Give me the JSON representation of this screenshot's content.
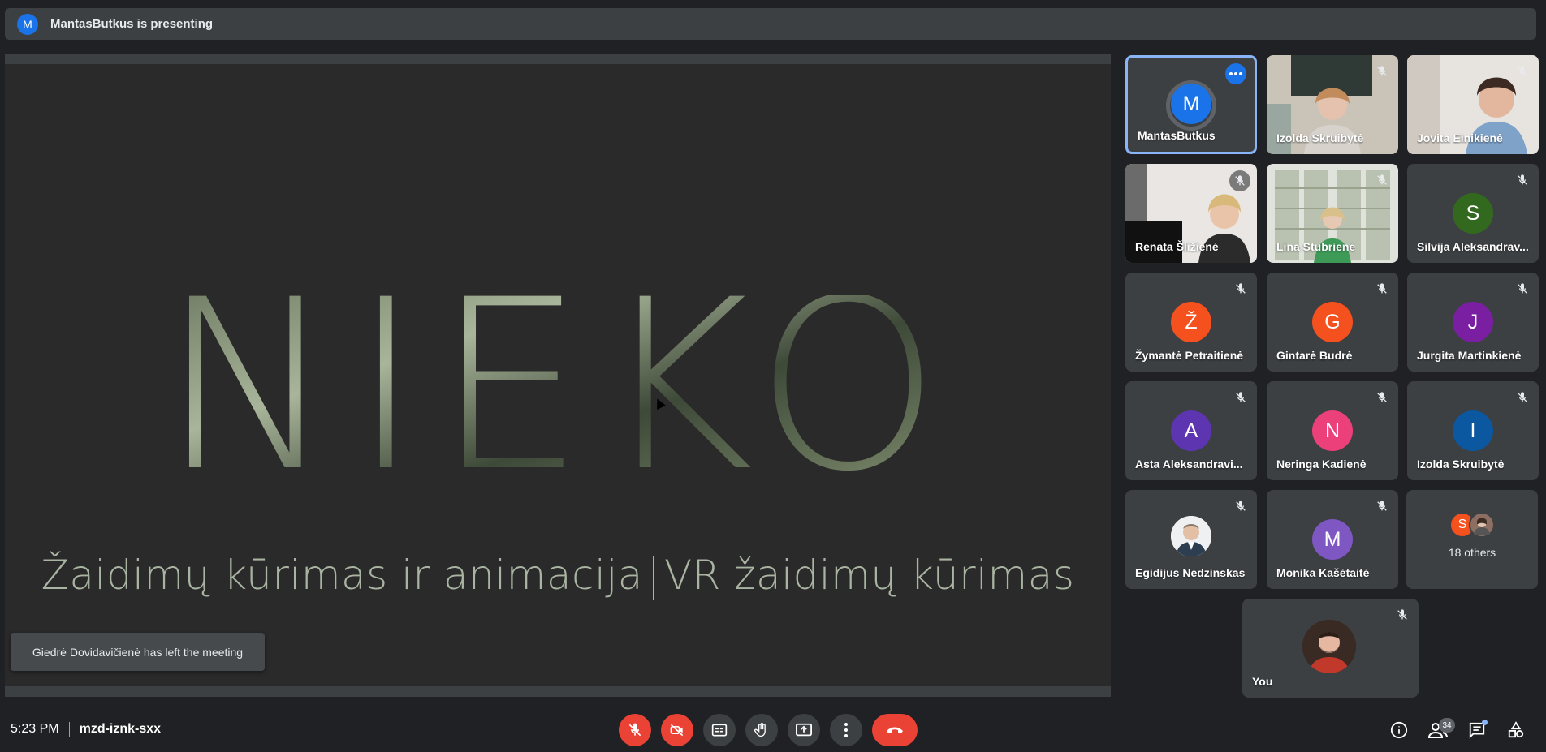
{
  "presenting": {
    "avatar_letter": "M",
    "text": "MantasButkus is presenting"
  },
  "slide": {
    "logo_text": "NIEKO",
    "subtitle_left": "Žaidimų kūrimas ir animacija",
    "subtitle_right": "VR žaidimų kūrimas"
  },
  "toast": "Giedrė Dovidavičienė has left the meeting",
  "participants": [
    {
      "name": "MantasButkus",
      "letter": "M",
      "color": "#1a73e8",
      "kind": "avatar-active"
    },
    {
      "name": "Izolda Skruibytė",
      "kind": "video"
    },
    {
      "name": "Jovita Einikienė",
      "kind": "video"
    },
    {
      "name": "Renata Šližienė",
      "kind": "video"
    },
    {
      "name": "Lina Stubrienė",
      "kind": "video"
    },
    {
      "name": "Silvija Aleksandrav...",
      "letter": "S",
      "color": "#33691e",
      "kind": "avatar"
    },
    {
      "name": "Žymantė Petraitienė",
      "letter": "Ž",
      "color": "#f4511e",
      "kind": "avatar"
    },
    {
      "name": "Gintarė Budrė",
      "letter": "G",
      "color": "#f4511e",
      "kind": "avatar"
    },
    {
      "name": "Jurgita Martinkienė",
      "letter": "J",
      "color": "#7b1fa2",
      "kind": "avatar"
    },
    {
      "name": "Asta Aleksandravi...",
      "letter": "A",
      "color": "#5e35b1",
      "kind": "avatar"
    },
    {
      "name": "Neringa Kadienė",
      "letter": "N",
      "color": "#ec407a",
      "kind": "avatar"
    },
    {
      "name": "Izolda Skruibytė",
      "letter": "I",
      "color": "#0b57a0",
      "kind": "avatar"
    },
    {
      "name": "Egidijus Nedzinskas",
      "kind": "photo"
    },
    {
      "name": "Monika Kašėtaitė",
      "letter": "M",
      "color": "#7e57c2",
      "kind": "avatar"
    }
  ],
  "others": {
    "label": "18 others",
    "mini_letter": "S",
    "mini_color": "#f4511e"
  },
  "self": {
    "name": "You"
  },
  "bottom": {
    "time": "5:23 PM",
    "meeting_code": "mzd-iznk-sxx",
    "people_count": "34"
  },
  "colors": {
    "accent": "#8ab4f8",
    "danger": "#ea4335",
    "surface": "#3c4043",
    "background": "#202124"
  }
}
